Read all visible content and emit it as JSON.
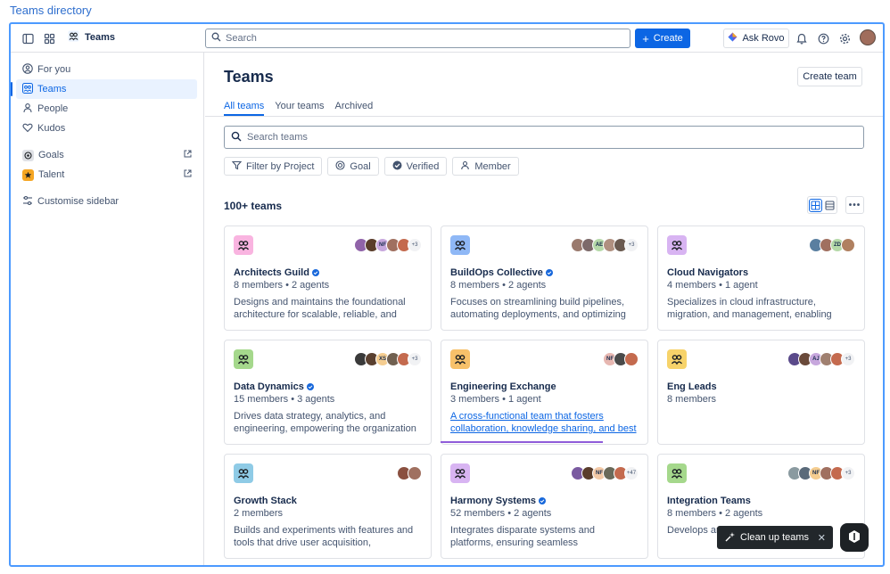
{
  "page_heading": "Teams directory",
  "topbar": {
    "brand": "Teams",
    "search_placeholder": "Search",
    "create_label": "Create",
    "rovo_label": "Ask Rovo"
  },
  "sidebar": {
    "items": [
      {
        "label": "For you",
        "icon": "person-circle-icon"
      },
      {
        "label": "Teams",
        "icon": "teams-icon",
        "active": true
      },
      {
        "label": "People",
        "icon": "person-icon"
      },
      {
        "label": "Kudos",
        "icon": "heart-icon"
      }
    ],
    "apps": [
      {
        "label": "Goals",
        "icon": "goals-icon"
      },
      {
        "label": "Talent",
        "icon": "talent-icon"
      }
    ],
    "customise": "Customise sidebar"
  },
  "main": {
    "title": "Teams",
    "create_team": "Create team",
    "tabs": [
      "All teams",
      "Your teams",
      "Archived"
    ],
    "search_placeholder": "Search teams",
    "filters": [
      "Filter by Project",
      "Goal",
      "Verified",
      "Member"
    ],
    "count": "100+ teams"
  },
  "cards": [
    {
      "name": "Architects Guild",
      "verified": true,
      "meta": "8 members • 2 agents",
      "desc": "Designs and maintains the foundational architecture for scalable, reliable, and secure",
      "icon_bg": "#f9b4e0",
      "avatars": [
        "#9063a8",
        "#5a3d2b",
        "NF",
        "#a07060",
        "#c46a4e"
      ],
      "more": "+3"
    },
    {
      "name": "BuildOps Collective",
      "verified": true,
      "meta": "8 members • 2 agents",
      "desc": "Focuses on streamlining build pipelines, automating deployments, and optimizing CI/",
      "icon_bg": "#8fb8f6",
      "avatars": [
        "#9a7a6e",
        "#7d6a6a",
        "AE",
        "#b09080",
        "#6a5a50"
      ],
      "more": "+3"
    },
    {
      "name": "Cloud Navigators",
      "verified": false,
      "meta": "4 members • 1 agent",
      "desc": "Specializes in cloud infrastructure, migration, and management, enabling teams to leverag",
      "icon_bg": "#d8b4f2",
      "avatars": [
        "#5a7fa0",
        "#a07060",
        "ZD",
        "#b08060"
      ],
      "more": ""
    },
    {
      "name": "Data Dynamics",
      "verified": true,
      "meta": "15 members • 3 agents",
      "desc": "Drives data strategy, analytics, and engineering, empowering the organization wi",
      "icon_bg": "#a5d88c",
      "avatars": [
        "#3a3a3a",
        "#5a4030",
        "XS",
        "#706050",
        "#c46a4e"
      ],
      "more": "+3"
    },
    {
      "name": "Engineering Exchange",
      "verified": false,
      "meta": "3 members • 1 agent",
      "desc": "A cross-functional team that fosters collaboration, knowledge sharing, and best p",
      "icon_bg": "#f7c16a",
      "avatars": [
        "NF",
        "#4a4a4a",
        "#c46a4e"
      ],
      "more": "",
      "link": true
    },
    {
      "name": "Eng Leads",
      "verified": false,
      "meta": "8 members",
      "desc": "",
      "icon_bg": "#f7d36a",
      "avatars": [
        "#5a4a8a",
        "#6a4a3a",
        "AJ",
        "#a08070",
        "#c46a4e"
      ],
      "more": "+3"
    },
    {
      "name": "Growth Stack",
      "verified": false,
      "meta": "2 members",
      "desc": "Builds and experiments with features and tools that drive user acquisition, engagement, and",
      "icon_bg": "#8fcbe6",
      "avatars": [
        "#8a5040",
        "#a07060"
      ],
      "more": ""
    },
    {
      "name": "Harmony Systems",
      "verified": true,
      "meta": "52 members • 2 agents",
      "desc": "Integrates disparate systems and platforms, ensuring seamless interoperability and a unifi",
      "icon_bg": "#d8b4f2",
      "avatars": [
        "#7a5aa0",
        "#5a3d2b",
        "NF",
        "#6a6a5a",
        "#c46a4e"
      ],
      "more": "+47"
    },
    {
      "name": "Integration Teams",
      "verified": false,
      "meta": "8 members • 2 agents",
      "desc": "Develops and integrations",
      "icon_bg": "#a5d88c",
      "avatars": [
        "#8a9aa0",
        "#5a6a7a",
        "NF",
        "#a07060",
        "#c46a4e"
      ],
      "more": "+3"
    }
  ],
  "toast": {
    "label": "Clean up teams"
  }
}
